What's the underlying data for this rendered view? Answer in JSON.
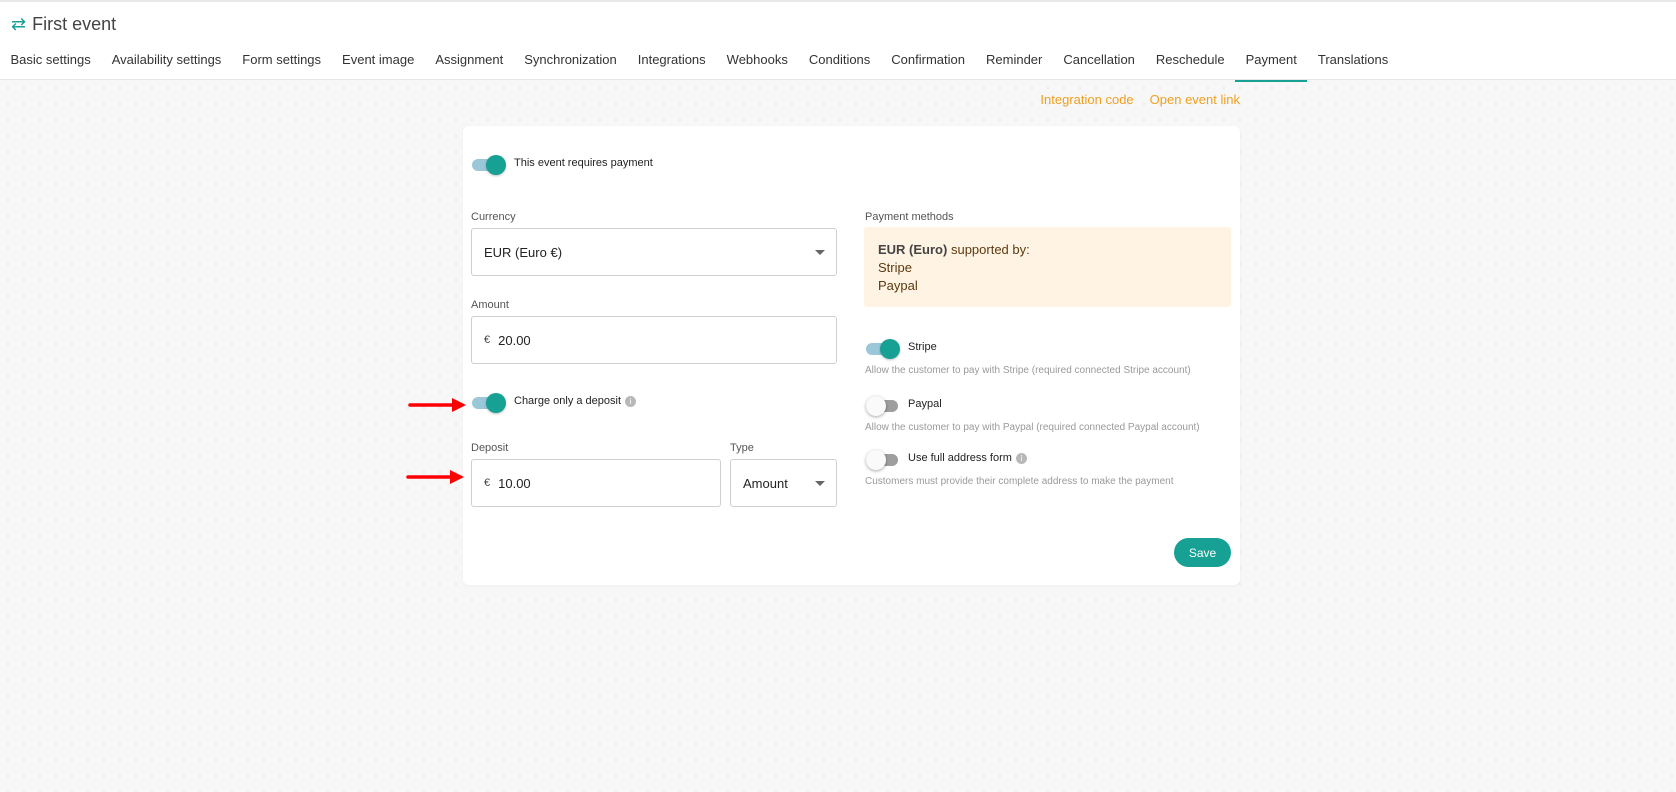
{
  "header": {
    "title": "First event",
    "title_icon": "swap-arrows-icon"
  },
  "tabs": [
    {
      "label": "Basic settings"
    },
    {
      "label": "Availability settings"
    },
    {
      "label": "Form settings"
    },
    {
      "label": "Event image"
    },
    {
      "label": "Assignment"
    },
    {
      "label": "Synchronization"
    },
    {
      "label": "Integrations"
    },
    {
      "label": "Webhooks"
    },
    {
      "label": "Conditions"
    },
    {
      "label": "Confirmation"
    },
    {
      "label": "Reminder"
    },
    {
      "label": "Cancellation"
    },
    {
      "label": "Reschedule"
    },
    {
      "label": "Payment",
      "active": true
    },
    {
      "label": "Translations"
    }
  ],
  "top_links": {
    "integration_code": "Integration code",
    "open_event_link": "Open event link"
  },
  "payment": {
    "requires_payment_label": "This event requires payment",
    "requires_payment_on": true,
    "currency": {
      "label": "Currency",
      "value": "EUR (Euro €)"
    },
    "amount": {
      "label": "Amount",
      "prefix": "€",
      "value": "20.00"
    },
    "deposit_toggle": {
      "label": "Charge only a deposit",
      "on": true
    },
    "deposit": {
      "label": "Deposit",
      "prefix": "€",
      "value": "10.00"
    },
    "type": {
      "label": "Type",
      "value": "Amount"
    }
  },
  "payment_methods": {
    "label": "Payment methods",
    "currency_name": "EUR (Euro)",
    "supported_by_text": "supported by:",
    "providers": [
      "Stripe",
      "Paypal"
    ],
    "stripe": {
      "label": "Stripe",
      "on": true,
      "hint": "Allow the customer to pay with Stripe (required connected Stripe account)"
    },
    "paypal": {
      "label": "Paypal",
      "on": false,
      "hint": "Allow the customer to pay with Paypal (required connected Paypal account)"
    },
    "full_address": {
      "label": "Use full address form",
      "on": false,
      "hint": "Customers must provide their complete address to make the payment"
    }
  },
  "save_label": "Save",
  "colors": {
    "accent": "#17a094",
    "link": "#f0a020",
    "annotation_arrow": "#ff0000"
  }
}
